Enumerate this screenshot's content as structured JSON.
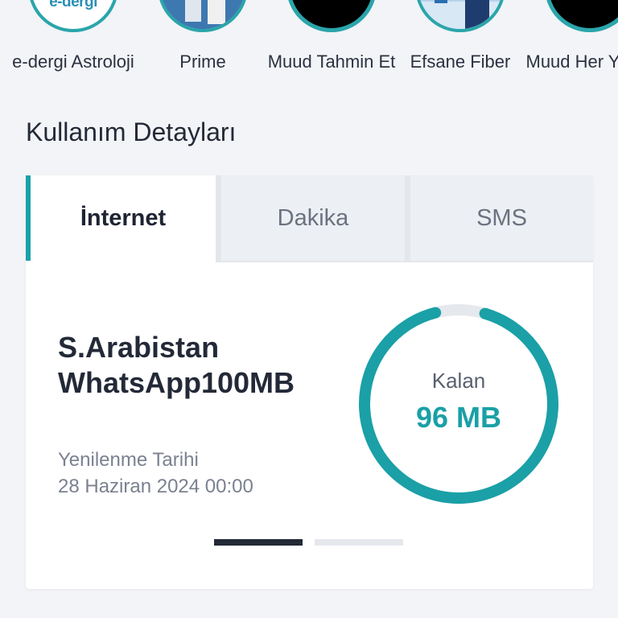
{
  "stories": [
    {
      "label": "e-dergi Astroloji",
      "logo_text": "e-dergi",
      "avatar": "e-dergi-logo"
    },
    {
      "label": "Prime",
      "avatar": "prime-thumbnail"
    },
    {
      "label": "Muud Tahmin Et",
      "avatar": "black-thumbnail"
    },
    {
      "label": "Efsane Fiber",
      "avatar": "fiber-thumbnail"
    },
    {
      "label": "Muud Her Yerde",
      "avatar": "black-thumbnail"
    }
  ],
  "usage": {
    "section_title": "Kullanım Detayları",
    "tabs": [
      {
        "label": "İnternet",
        "active": true
      },
      {
        "label": "Dakika",
        "active": false
      },
      {
        "label": "SMS",
        "active": false
      }
    ],
    "package_name": "S.Arabistan WhatsApp100MB",
    "renewal_label": "Yenilenme Tarihi",
    "renewal_date": "28 Haziran 2024 00:00",
    "remaining_label": "Kalan",
    "remaining_value": "96 MB",
    "remaining_fraction": 0.96,
    "pager_count": 2,
    "pager_active_index": 0
  },
  "colors": {
    "accent": "#1aa0a6",
    "ring_track": "#e5e8ec",
    "background": "#f2f4f7",
    "text_dark": "#232937"
  }
}
